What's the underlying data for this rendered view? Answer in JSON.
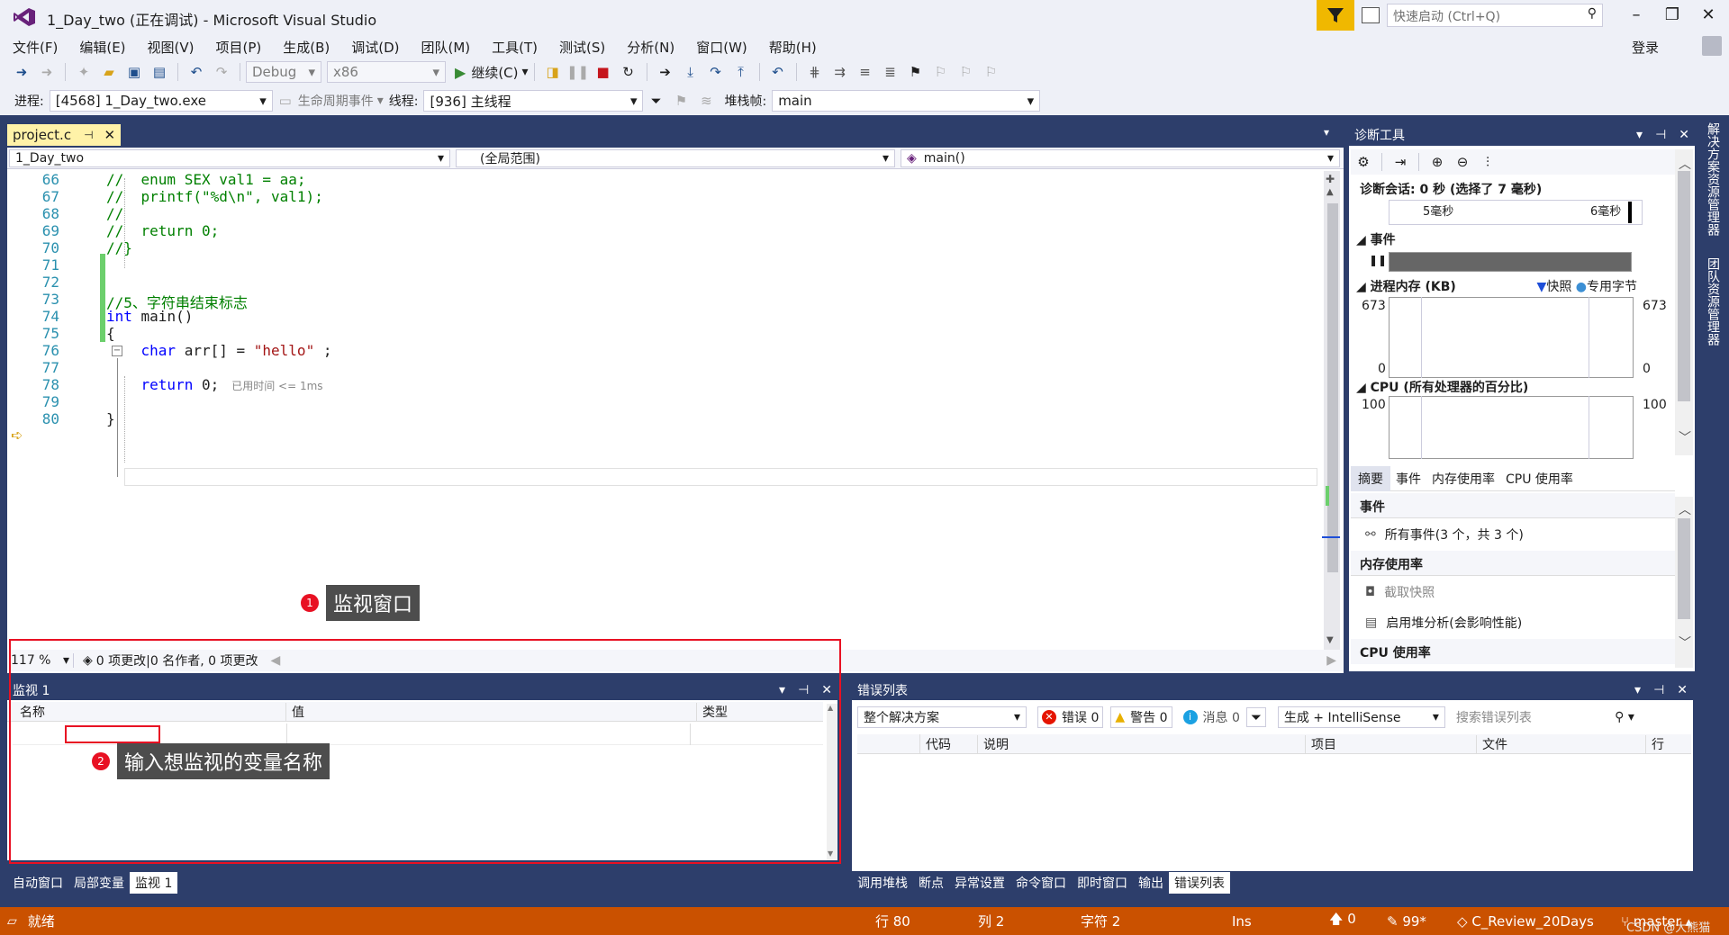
{
  "titlebar": {
    "title": "1_Day_two (正在调试) - Microsoft Visual Studio",
    "quick_launch": "快速启动 (Ctrl+Q)",
    "login": "登录"
  },
  "menu": [
    "文件(F)",
    "编辑(E)",
    "视图(V)",
    "项目(P)",
    "生成(B)",
    "调试(D)",
    "团队(M)",
    "工具(T)",
    "测试(S)",
    "分析(N)",
    "窗口(W)",
    "帮助(H)"
  ],
  "toolbar": {
    "config": "Debug",
    "platform": "x86",
    "continue": "继续(C)"
  },
  "debugbar": {
    "process_label": "进程:",
    "process": "[4568] 1_Day_two.exe",
    "lifecycle": "生命周期事件",
    "thread_label": "线程:",
    "thread": "[936] 主线程",
    "frame_label": "堆栈帧:",
    "frame": "main"
  },
  "editor": {
    "tab": "project.c",
    "nav": {
      "project": "1_Day_two",
      "scope": "(全局范围)",
      "func": "main()"
    },
    "lines": [
      {
        "n": "66",
        "text": "//  enum SEX val1 = aa;",
        "cls": "cmt"
      },
      {
        "n": "67",
        "text": "//  printf(\"%d\\n\", val1);",
        "cls": "cmt"
      },
      {
        "n": "68",
        "text": "//",
        "cls": "cmt"
      },
      {
        "n": "69",
        "text": "//  return 0;",
        "cls": "cmt"
      },
      {
        "n": "70",
        "text": "//}",
        "cls": "cmt"
      },
      {
        "n": "71",
        "text": "",
        "cls": ""
      },
      {
        "n": "72",
        "text": "",
        "cls": ""
      },
      {
        "n": "73",
        "text": "//5、字符串结束标志",
        "cls": "cmt"
      },
      {
        "n": "74",
        "text": "",
        "cls": ""
      },
      {
        "n": "75",
        "text": "{",
        "cls": ""
      },
      {
        "n": "76",
        "text": "",
        "cls": ""
      },
      {
        "n": "77",
        "text": "",
        "cls": ""
      },
      {
        "n": "78",
        "text": "",
        "cls": ""
      },
      {
        "n": "79",
        "text": "",
        "cls": ""
      },
      {
        "n": "80",
        "text": "}",
        "cls": ""
      }
    ],
    "kw_int": "int",
    "main_sig": " main()",
    "kw_char": "char",
    "arr_decl": " arr[] = ",
    "str_hello": "\"hello\"",
    "semi": " ;",
    "kw_return": "return",
    "ret_zero": " 0;",
    "elapsed": "已用时间 <= 1ms",
    "zoom": "117 %",
    "changes": "0 项更改|0 名作者, 0 项更改"
  },
  "annotations": {
    "one": "1",
    "one_text": "监视窗口",
    "two": "2",
    "two_text": "输入想监视的变量名称"
  },
  "watch": {
    "title": "监视 1",
    "cols": [
      "名称",
      "值",
      "类型"
    ],
    "tabs": [
      "自动窗口",
      "局部变量",
      "监视 1"
    ]
  },
  "errors": {
    "title": "错误列表",
    "scope": "整个解决方案",
    "errors": "错误 0",
    "warnings": "警告 0",
    "messages": "消息 0",
    "build": "生成 + IntelliSense",
    "search": "搜索错误列表",
    "cols": [
      "代码",
      "说明",
      "项目",
      "文件",
      "行"
    ],
    "tabs": [
      "调用堆栈",
      "断点",
      "异常设置",
      "命令窗口",
      "即时窗口",
      "输出",
      "错误列表"
    ]
  },
  "diag": {
    "title": "诊断工具",
    "session": "诊断会话: 0 秒 (选择了 7 毫秒)",
    "t5": "5毫秒",
    "t6": "6毫秒",
    "events": "事件",
    "mem": "进程内存 (KB)",
    "snapshot": "快照",
    "private": "专用字节",
    "mem_max": "673",
    "mem_min": "0",
    "cpu": "CPU (所有处理器的百分比)",
    "cpu_max": "100",
    "tabs": [
      "摘要",
      "事件",
      "内存使用率",
      "CPU 使用率"
    ],
    "sec_events": "事件",
    "all_events": "所有事件(3 个，共 3 个)",
    "sec_mem": "内存使用率",
    "take_snapshot": "截取快照",
    "heap": "启用堆分析(会影响性能)",
    "sec_cpu": "CPU 使用率"
  },
  "sidebar": {
    "a": "解决方案资源管理器",
    "b": "团队资源管理器"
  },
  "status": {
    "ready": "就绪",
    "row": "行 80",
    "col": "列 2",
    "ch": "字符 2",
    "ins": "Ins",
    "up": "0",
    "pen": "99*",
    "repo": "C_Review_20Days",
    "branch": "master",
    "watermark": "CSDN @大熊猫"
  }
}
